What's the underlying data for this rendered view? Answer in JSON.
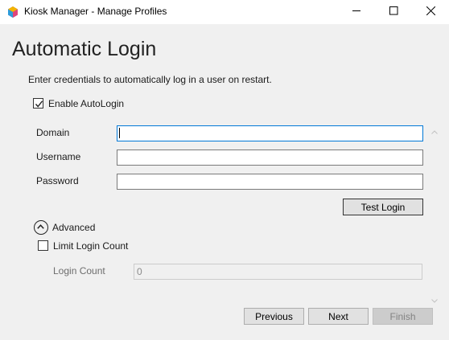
{
  "window": {
    "title": "Kiosk Manager - Manage Profiles",
    "app_icon": "kiosk-manager-icon",
    "controls": [
      "minimize-icon",
      "maximize-icon",
      "close-icon"
    ]
  },
  "page": {
    "heading": "Automatic Login",
    "instructions": "Enter credentials to automatically log in a user on restart."
  },
  "autologin": {
    "label": "Enable AutoLogin",
    "checked": true
  },
  "fields": {
    "domain": {
      "label": "Domain",
      "value": ""
    },
    "username": {
      "label": "Username",
      "value": ""
    },
    "password": {
      "label": "Password",
      "value": ""
    }
  },
  "test_login_label": "Test Login",
  "advanced": {
    "label": "Advanced",
    "expanded": true,
    "limit_login_count": {
      "label": "Limit Login Count",
      "checked": false
    },
    "login_count": {
      "label": "Login Count",
      "value": "0",
      "enabled": false
    }
  },
  "nav": {
    "previous_label": "Previous",
    "next_label": "Next",
    "finish_label": "Finish",
    "finish_enabled": false
  },
  "colors": {
    "accent": "#0078d7",
    "background": "#f0f0f0"
  }
}
